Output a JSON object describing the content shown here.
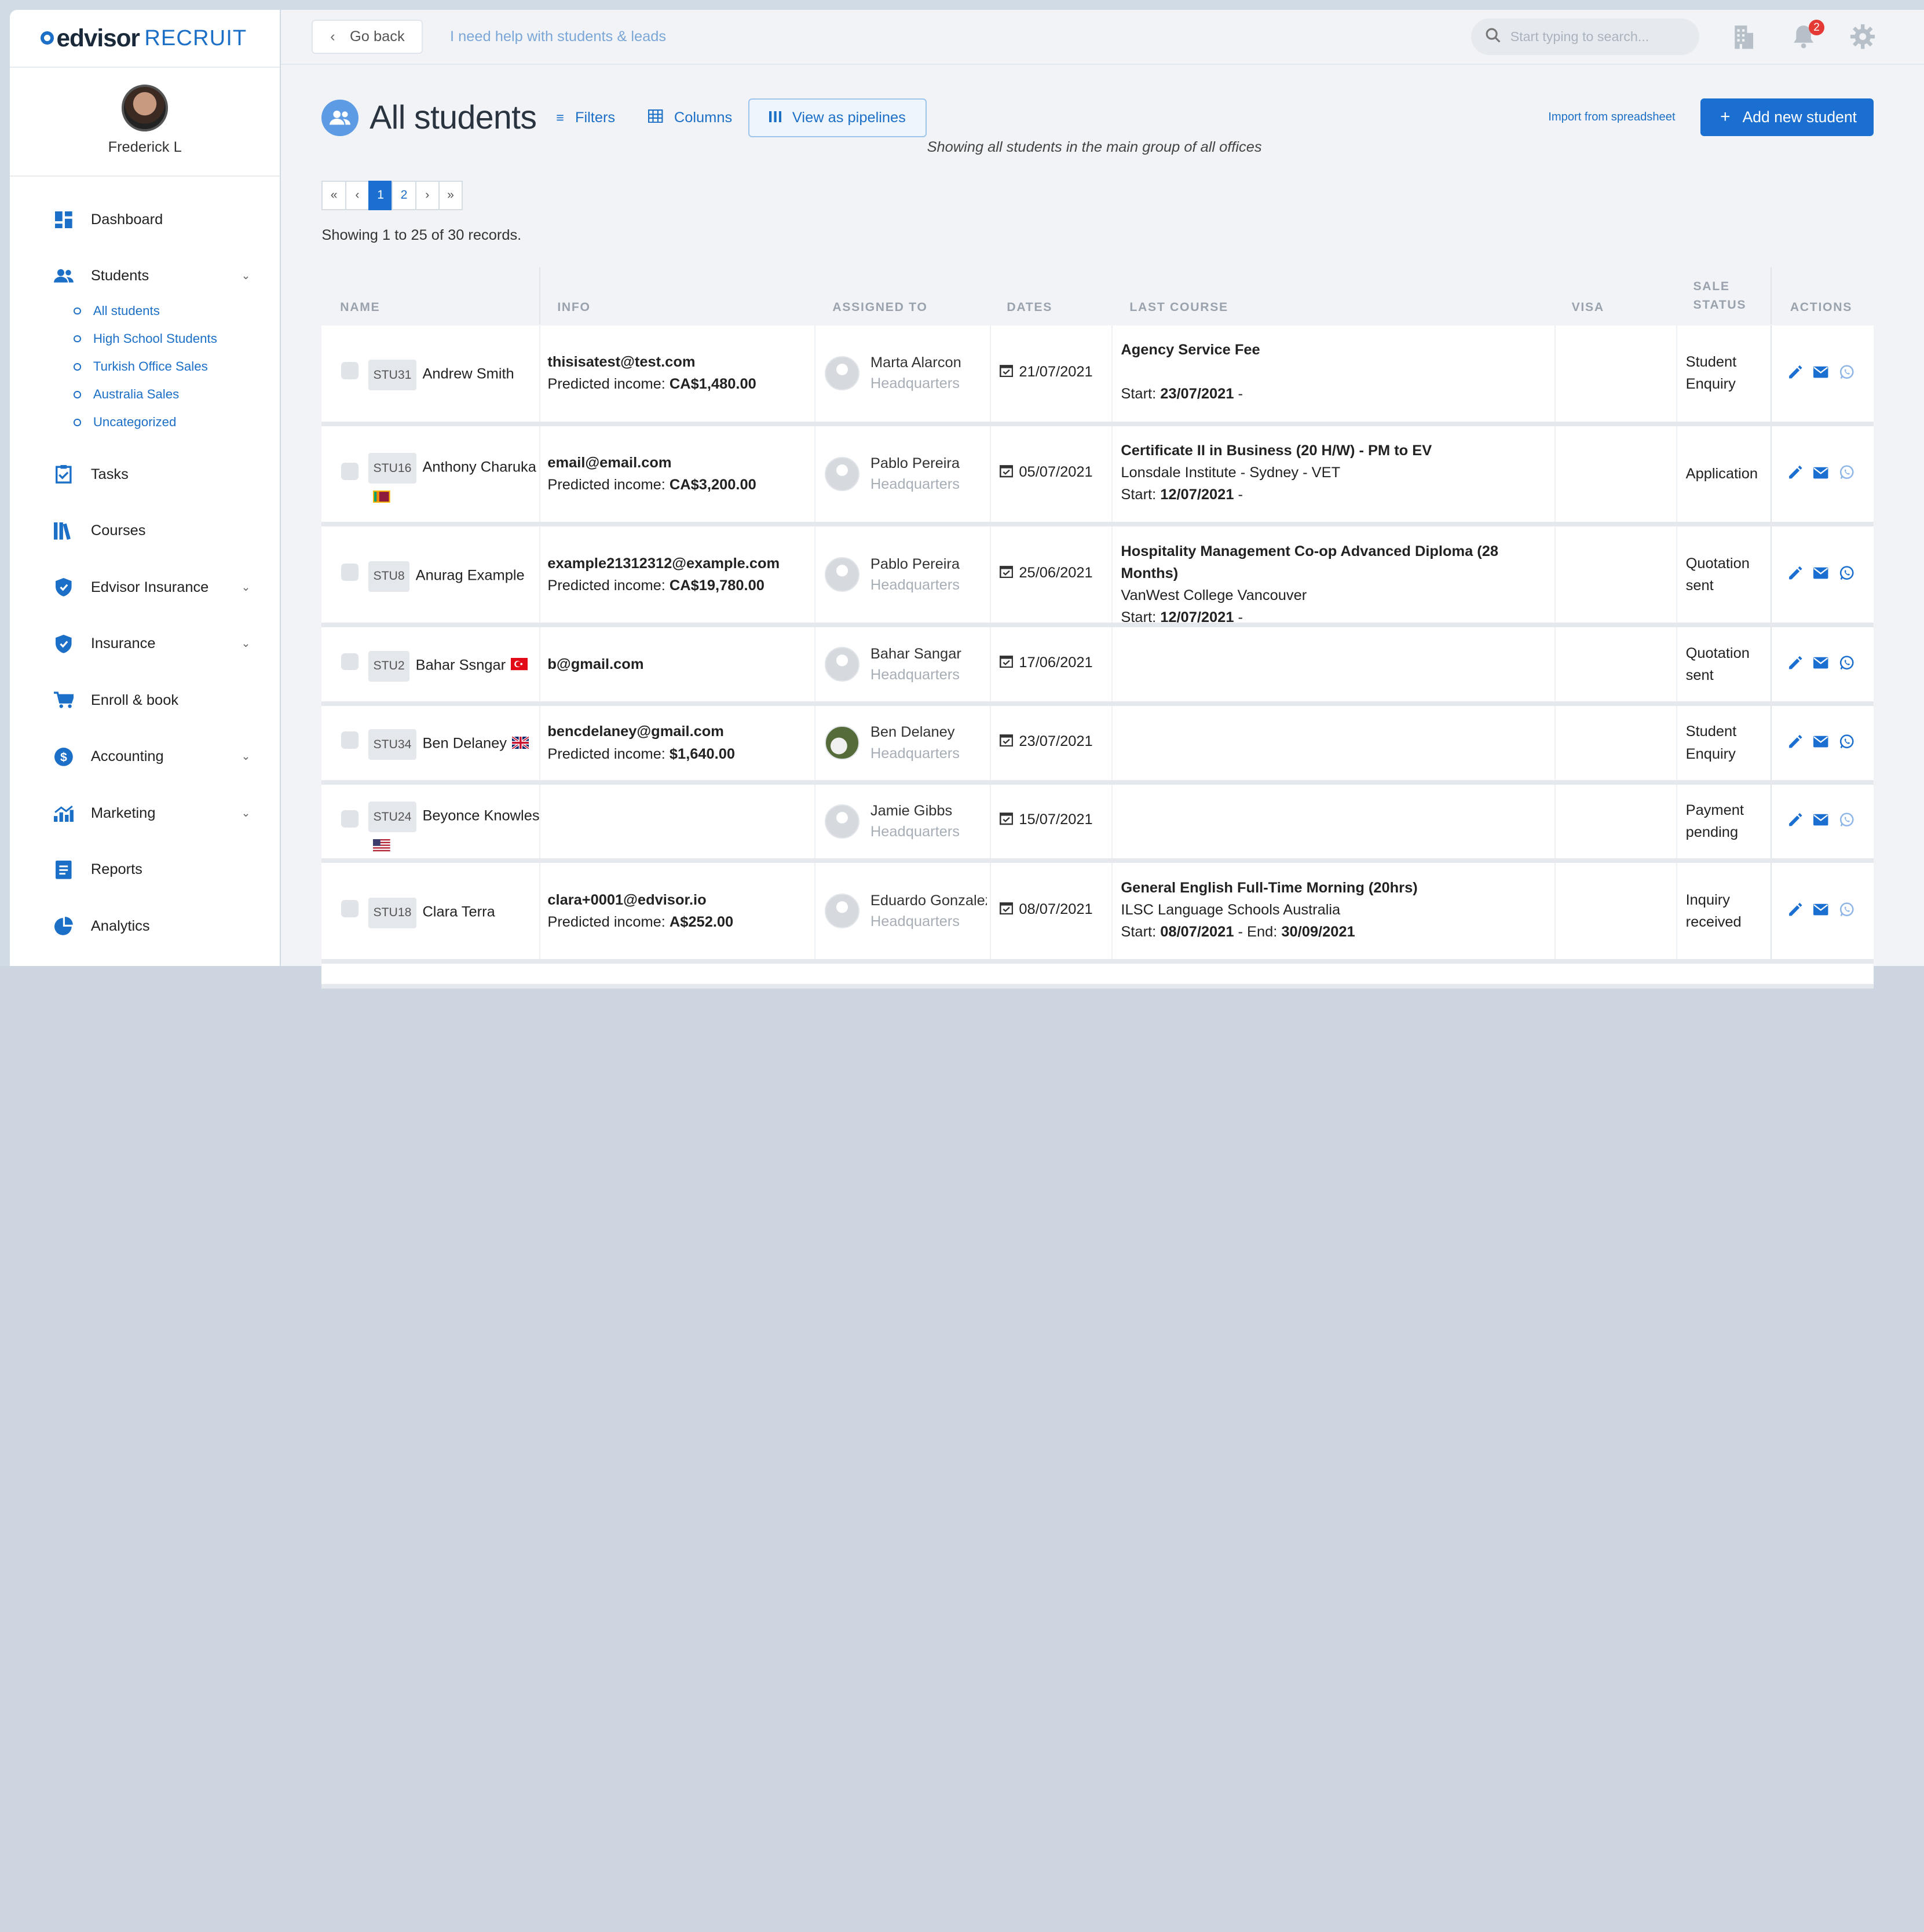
{
  "app": {
    "logo_main": "edvisor",
    "logo_sub": "RECRUIT"
  },
  "user": {
    "name": "Frederick L"
  },
  "sidebar": {
    "items": [
      {
        "label": "Dashboard",
        "icon": "dashboard-icon"
      },
      {
        "label": "Students",
        "icon": "students-icon",
        "expandable": true
      },
      {
        "label": "Tasks",
        "icon": "tasks-icon"
      },
      {
        "label": "Courses",
        "icon": "courses-icon"
      },
      {
        "label": "Edvisor Insurance",
        "icon": "shield-icon",
        "expandable": true
      },
      {
        "label": "Insurance",
        "icon": "shield-icon",
        "expandable": true
      },
      {
        "label": "Enroll & book",
        "icon": "cart-icon"
      },
      {
        "label": "Accounting",
        "icon": "dollar-icon",
        "expandable": true
      },
      {
        "label": "Marketing",
        "icon": "marketing-icon",
        "expandable": true
      },
      {
        "label": "Reports",
        "icon": "reports-icon"
      },
      {
        "label": "Analytics",
        "icon": "analytics-icon"
      }
    ],
    "students_sub": [
      "All students",
      "High School Students",
      "Turkish Office Sales",
      "Australia Sales",
      "Uncategorized"
    ]
  },
  "topbar": {
    "go_back": "Go back",
    "help": "I need help with students & leads",
    "search_placeholder": "Start typing to search...",
    "notifications_count": "2"
  },
  "page": {
    "title": "All students",
    "filters": "Filters",
    "columns": "Columns",
    "pipelines": "View as pipelines",
    "import": "Import from spreadsheet",
    "add": "Add new student",
    "subtitle": "Showing all students  in the main group  of all offices",
    "records": "Showing 1 to 25 of 30 records."
  },
  "pager": [
    "«",
    "‹",
    "1",
    "2",
    "›",
    "»"
  ],
  "table": {
    "headers": {
      "name": "NAME",
      "info": "INFO",
      "assigned": "ASSIGNED TO",
      "dates": "DATES",
      "last_course": "LAST COURSE",
      "visa": "VISA",
      "sale_status": "SALE STATUS",
      "actions": "ACTIONS"
    },
    "rows": [
      {
        "id": "STU31",
        "name": "Andrew Smith",
        "flag": "",
        "email": "thisisatest@test.com",
        "income_label": "Predicted income: ",
        "income": "CA$1,480.00",
        "assigned": "Marta Alarcon",
        "office": "Headquarters",
        "photo": false,
        "date": "21/07/2021",
        "course": "Agency Service Fee",
        "school": "",
        "start": "Start: ",
        "start_date": "23/07/2021",
        "end_sep": " -",
        "end": "",
        "status": [
          "Student",
          "Enquiry"
        ],
        "wa_light": true
      },
      {
        "id": "STU16",
        "name": "Anthony Charuka",
        "flag": "lk",
        "email": "email@email.com",
        "income_label": "Predicted income: ",
        "income": "CA$3,200.00",
        "assigned": "Pablo Pereira",
        "office": "Headquarters",
        "photo": false,
        "date": "05/07/2021",
        "course": "Certificate II in Business (20 H/W) - PM to EV",
        "school": "Lonsdale Institute - Sydney - VET",
        "start": "Start: ",
        "start_date": "12/07/2021",
        "end_sep": " -",
        "end": "",
        "status": [
          "Application"
        ],
        "wa_light": true
      },
      {
        "id": "STU8",
        "name": "Anurag Example",
        "flag": "",
        "email": "example21312312@example.com",
        "income_label": "Predicted income: ",
        "income": "CA$19,780.00",
        "assigned": "Pablo Pereira",
        "office": "Headquarters",
        "photo": false,
        "date": "25/06/2021",
        "course": "Hospitality Management Co-op Advanced Diploma (28 Months)",
        "school": "VanWest College Vancouver",
        "start": "Start: ",
        "start_date": "12/07/2021",
        "end_sep": " -",
        "end": "",
        "status": [
          "Quotation",
          "sent"
        ],
        "wa_light": false
      },
      {
        "id": "STU2",
        "name": "Bahar Ssngar",
        "flag": "tr",
        "email": "b@gmail.com",
        "income_label": "",
        "income": "",
        "assigned": "Bahar Sangar",
        "office": "Headquarters",
        "photo": false,
        "date": "17/06/2021",
        "course": "",
        "school": "",
        "start": "",
        "start_date": "",
        "end_sep": "",
        "end": "",
        "status": [
          "Quotation",
          "sent"
        ],
        "wa_light": false
      },
      {
        "id": "STU34",
        "name": "Ben Delaney",
        "flag": "uk",
        "email": "bencdelaney@gmail.com",
        "income_label": "Predicted income: ",
        "income": "$1,640.00",
        "assigned": "Ben Delaney",
        "office": "Headquarters",
        "photo": true,
        "date": "23/07/2021",
        "course": "",
        "school": "",
        "start": "",
        "start_date": "",
        "end_sep": "",
        "end": "",
        "status": [
          "Student",
          "Enquiry"
        ],
        "wa_light": false
      },
      {
        "id": "STU24",
        "name": "Beyonce Knowles",
        "flag": "us",
        "email": "",
        "income_label": "",
        "income": "",
        "assigned": "Jamie Gibbs",
        "office": "Headquarters",
        "photo": false,
        "date": "15/07/2021",
        "course": "",
        "school": "",
        "start": "",
        "start_date": "",
        "end_sep": "",
        "end": "",
        "status": [
          "Payment",
          "pending"
        ],
        "wa_light": true
      },
      {
        "id": "STU18",
        "name": "Clara Terra",
        "flag": "",
        "email": "clara+0001@edvisor.io",
        "income_label": "Predicted income: ",
        "income": "A$252.00",
        "assigned": "Eduardo Gonzalez",
        "office": "Headquarters",
        "photo": false,
        "date": "08/07/2021",
        "course": "General English Full-Time Morning (20hrs)",
        "school": "ILSC Language Schools Australia",
        "start": "Start: ",
        "start_date": "08/07/2021",
        "end_sep": " - End: ",
        "end": "30/09/2021",
        "status": [
          "Inquiry",
          "received"
        ],
        "wa_light": true
      }
    ]
  },
  "colors": {
    "accent": "#1a6fd0",
    "link": "#1c6fc6",
    "badge": "#e53935"
  }
}
